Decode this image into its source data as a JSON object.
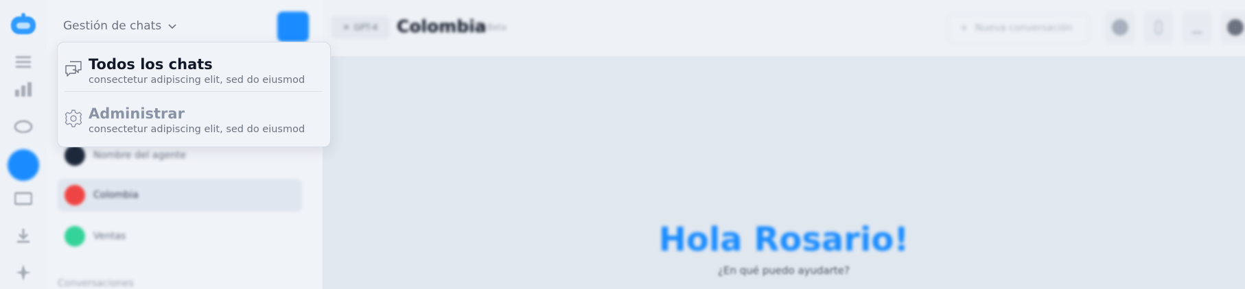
{
  "sidebar": {
    "header_label": "Gestión de chats",
    "agents": [
      {
        "name": "Nombre del agente",
        "color": "#1e293b",
        "selected": false
      },
      {
        "name": "Colombia",
        "color": "#ef4444",
        "selected": true
      },
      {
        "name": "Ventas",
        "color": "#34d399",
        "selected": false
      }
    ],
    "section_title": "Conversaciones"
  },
  "dropdown": {
    "items": [
      {
        "title": "Todos los chats",
        "description": "consectetur adipiscing elit, sed do eiusmod",
        "icon": "chat-bubbles-icon"
      },
      {
        "title": "Administrar",
        "description": "consectetur adipiscing elit, sed do eiusmod",
        "icon": "gear-icon"
      }
    ]
  },
  "topbar": {
    "model_label": "GPT-4",
    "title": "Colombia",
    "badge": "Beta",
    "new_conversation_label": "Nueva conversación"
  },
  "main": {
    "greeting": "Hola Rosario!",
    "subtitle": "¿En qué puedo ayudarte?"
  },
  "colors": {
    "accent": "#1a8cff",
    "background": "#eef2f7",
    "main_background": "#e1e7ef"
  }
}
